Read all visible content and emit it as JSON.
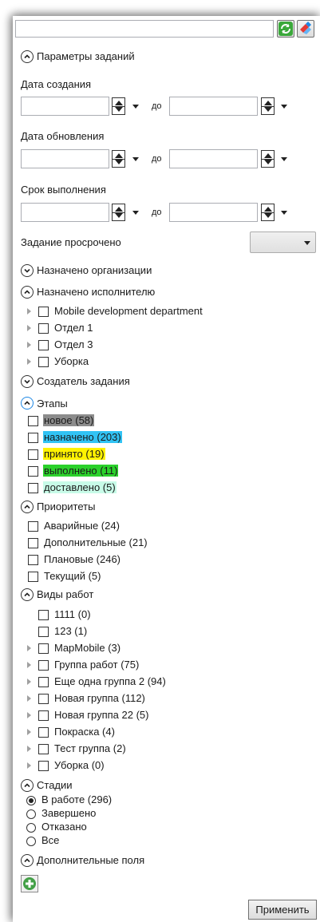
{
  "search": {
    "value": "",
    "placeholder": ""
  },
  "toolbar": {
    "refresh_icon": "refresh-icon",
    "clear_icon": "eraser-icon"
  },
  "task_params": {
    "title": "Параметры заданий",
    "created_label": "Дата создания",
    "updated_label": "Дата обновления",
    "due_label": "Срок выполнения",
    "to_label": "до",
    "overdue_label": "Задание просрочено",
    "overdue_value": ""
  },
  "assigned_org": {
    "title": "Назначено организации"
  },
  "assigned_exec": {
    "title": "Назначено исполнителю",
    "items": [
      {
        "label": "Mobile development department"
      },
      {
        "label": "Отдел 1"
      },
      {
        "label": "Отдел 3"
      },
      {
        "label": "Уборка"
      }
    ]
  },
  "creator": {
    "title": "Создатель задания"
  },
  "stages": {
    "title": "Этапы",
    "items": [
      {
        "label": "новое (58)",
        "color": "#8c8c8c"
      },
      {
        "label": "назначено (203)",
        "color": "#31c3f4"
      },
      {
        "label": "принято (19)",
        "color": "#fff200"
      },
      {
        "label": "выполнено (11)",
        "color": "#2bd12b"
      },
      {
        "label": "доставлено (5)",
        "color": "#c8fbe8"
      }
    ]
  },
  "priorities": {
    "title": "Приоритеты",
    "items": [
      {
        "label": "Аварийные (24)"
      },
      {
        "label": "Дополнительные (21)"
      },
      {
        "label": "Плановые (246)"
      },
      {
        "label": "Текущий (5)"
      }
    ]
  },
  "work_types": {
    "title": "Виды работ",
    "items": [
      {
        "label": "1111 (0)"
      },
      {
        "label": "123 (1)"
      },
      {
        "label": "MapMobile (3)"
      },
      {
        "label": "Группа работ (75)"
      },
      {
        "label": "Еще одна группа 2 (94)"
      },
      {
        "label": "Новая группа (112)"
      },
      {
        "label": "Новая группа 22 (5)"
      },
      {
        "label": "Покраска (4)"
      },
      {
        "label": "Тест группа (2)"
      },
      {
        "label": "Уборка (0)"
      }
    ]
  },
  "phases": {
    "title": "Стадии",
    "selected": "В работе (296)",
    "items": [
      {
        "label": "В работе (296)"
      },
      {
        "label": "Завершено"
      },
      {
        "label": "Отказано"
      },
      {
        "label": "Все"
      }
    ]
  },
  "extra_fields": {
    "title": "Дополнительные поля"
  },
  "apply_label": "Применить"
}
